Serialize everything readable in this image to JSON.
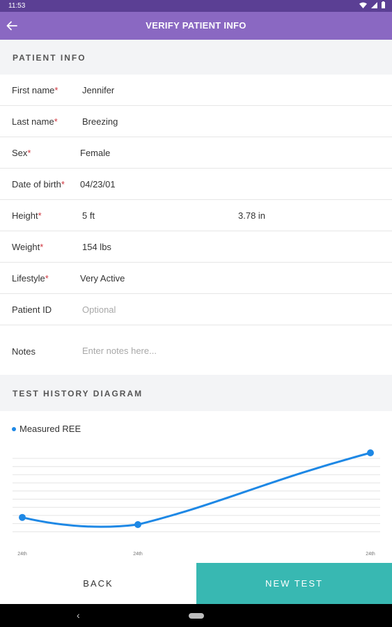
{
  "status_bar": {
    "time": "11:53"
  },
  "app_bar": {
    "title": "VERIFY PATIENT INFO",
    "back_icon": "arrow-left-icon"
  },
  "sections": {
    "patient_info": "PATIENT INFO",
    "test_history": "TEST HISTORY DIAGRAM"
  },
  "fields": {
    "first_name": {
      "label": "First name",
      "required": "*",
      "value": "Jennifer"
    },
    "last_name": {
      "label": "Last name",
      "required": "*",
      "value": "Breezing"
    },
    "sex": {
      "label": "Sex",
      "required": "*",
      "value": "Female"
    },
    "dob": {
      "label": "Date of birth",
      "required": "*",
      "value": "04/23/01"
    },
    "height": {
      "label": "Height",
      "required": "*",
      "value_ft": "5 ft",
      "value_in": "3.78 in"
    },
    "weight": {
      "label": "Weight",
      "required": "*",
      "value": "154 lbs"
    },
    "lifestyle": {
      "label": "Lifestyle",
      "required": "*",
      "value": "Very Active"
    },
    "patient_id": {
      "label": "Patient ID",
      "placeholder": "Optional"
    },
    "notes": {
      "label": "Notes",
      "placeholder": "Enter notes here..."
    }
  },
  "chart_data": {
    "type": "line",
    "legend": "Measured REE",
    "series": [
      {
        "name": "Measured REE",
        "color": "#1e88e5",
        "values": [
          1,
          0,
          10
        ]
      }
    ],
    "x_labels": [
      "24th",
      "24th",
      "24th"
    ],
    "grid": true
  },
  "buttons": {
    "back": "BACK",
    "new_test": "NEW TEST"
  },
  "colors": {
    "app_bar": "#8a68c2",
    "status_bar": "#5b3f94",
    "accent": "#38b8b2",
    "series": "#1e88e5",
    "required": "#d0363f"
  }
}
